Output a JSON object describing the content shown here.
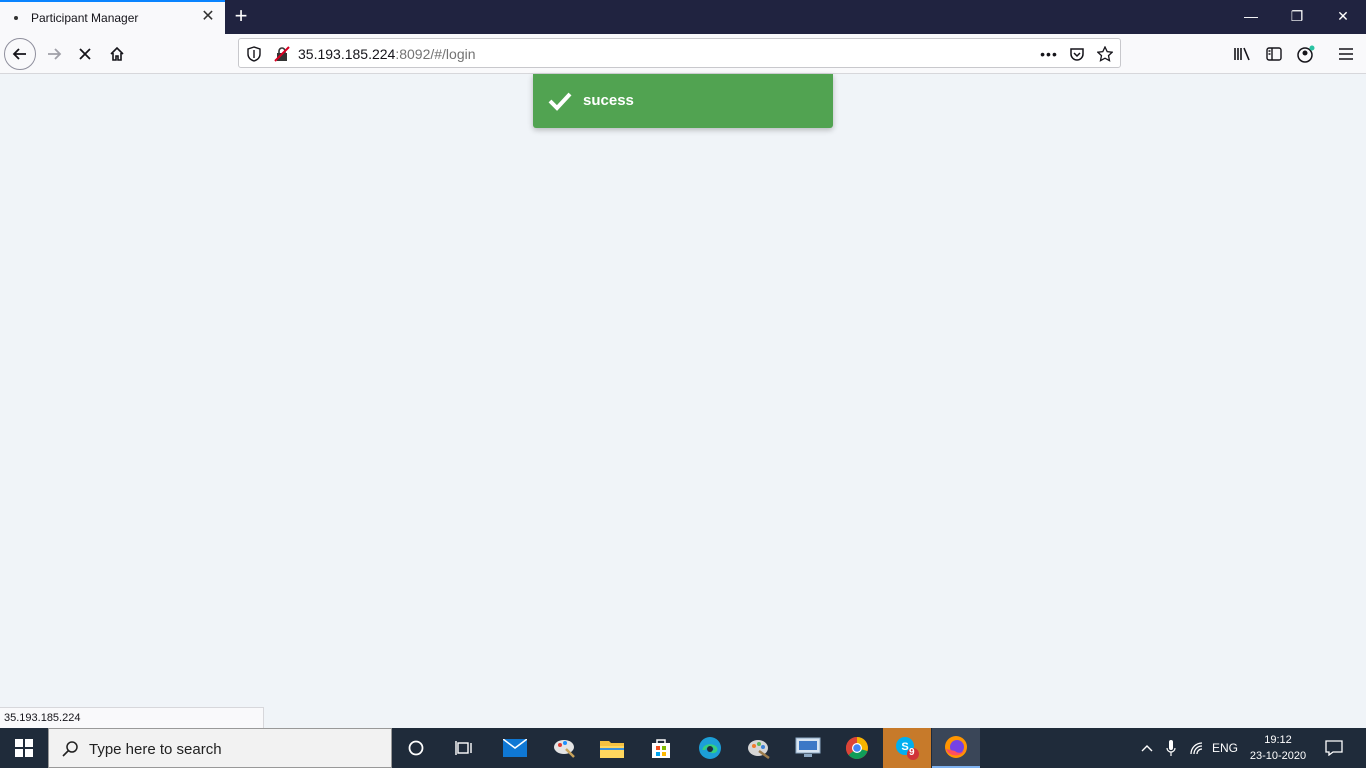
{
  "browser": {
    "tab_title": "Participant Manager",
    "url_host": "35.193.185.224",
    "url_rest": ":8092/#/login",
    "status_url": "35.193.185.224"
  },
  "toast": {
    "message": "sucess",
    "color": "#51a351",
    "icon": "check-icon"
  },
  "taskbar": {
    "search_placeholder": "Type here to search",
    "apps": [
      "cortana-icon",
      "task-view-icon",
      "mail-icon",
      "paint-icon",
      "file-explorer-icon",
      "store-icon",
      "edge-icon",
      "paint3d-icon",
      "remote-desktop-icon",
      "chrome-icon",
      "skype-icon",
      "firefox-icon"
    ],
    "skype_badge": "9",
    "language": "ENG",
    "time": "19:12",
    "date": "23-10-2020"
  }
}
